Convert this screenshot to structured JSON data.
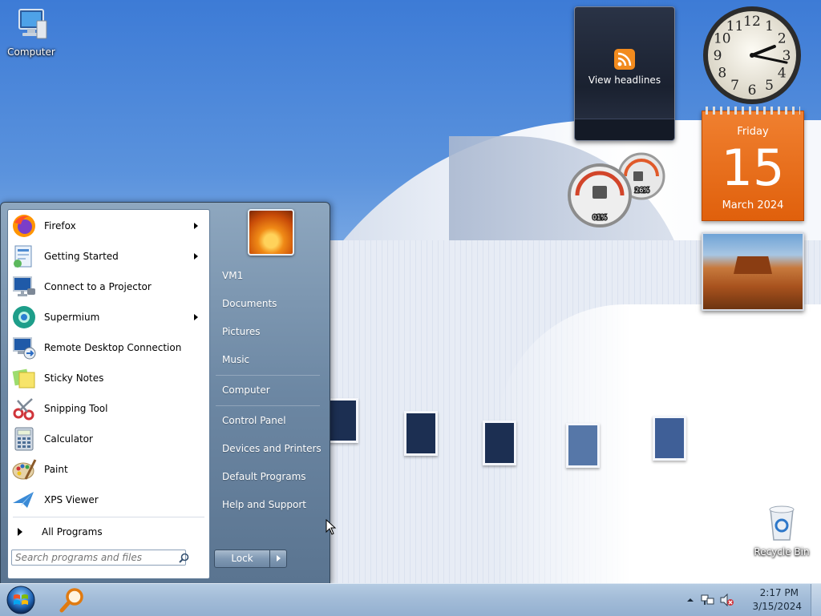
{
  "desktop": {
    "icons": [
      {
        "label": "Computer"
      },
      {
        "label": "Recycle Bin"
      }
    ]
  },
  "gadgets": {
    "feed": {
      "label": "View headlines",
      "icon": "rss-icon"
    },
    "clock": {
      "hour": 2,
      "minute": 17,
      "numerals": [
        "12",
        "1",
        "2",
        "3",
        "4",
        "5",
        "6",
        "7",
        "8",
        "9",
        "10",
        "11"
      ]
    },
    "calendar": {
      "day_name": "Friday",
      "day_number": "15",
      "month_year": "March 2024"
    },
    "cpu_meter": {
      "cpu_percent": "01%",
      "memory_percent": "26%"
    },
    "slideshow": {
      "subject": "desert mesa photo"
    }
  },
  "start_menu": {
    "programs": [
      {
        "label": "Firefox",
        "icon": "firefox-icon",
        "submenu": true
      },
      {
        "label": "Getting Started",
        "icon": "getting-started-icon",
        "submenu": true
      },
      {
        "label": "Connect to a Projector",
        "icon": "projector-icon",
        "submenu": false
      },
      {
        "label": "Supermium",
        "icon": "supermium-icon",
        "submenu": true
      },
      {
        "label": "Remote Desktop Connection",
        "icon": "remote-desktop-icon",
        "submenu": false
      },
      {
        "label": "Sticky Notes",
        "icon": "sticky-notes-icon",
        "submenu": false
      },
      {
        "label": "Snipping Tool",
        "icon": "snipping-tool-icon",
        "submenu": false
      },
      {
        "label": "Calculator",
        "icon": "calculator-icon",
        "submenu": false
      },
      {
        "label": "Paint",
        "icon": "paint-icon",
        "submenu": false
      },
      {
        "label": "XPS Viewer",
        "icon": "xps-viewer-icon",
        "submenu": false
      }
    ],
    "all_programs": "All Programs",
    "search_placeholder": "Search programs and files",
    "right_items": {
      "user": "VM1",
      "documents": "Documents",
      "pictures": "Pictures",
      "music": "Music",
      "computer": "Computer",
      "control_panel": "Control Panel",
      "devices": "Devices and Printers",
      "default_programs": "Default Programs",
      "help": "Help and Support"
    },
    "lock_label": "Lock"
  },
  "taskbar": {
    "time": "2:17 PM",
    "date": "3/15/2024",
    "tray_icons": [
      "show-hidden-icons-arrow",
      "network-icon",
      "volume-muted-icon"
    ]
  },
  "colors": {
    "calendar": "#e8680f",
    "rss": "#f28b1e",
    "taskbar": "#a3bcd8"
  }
}
